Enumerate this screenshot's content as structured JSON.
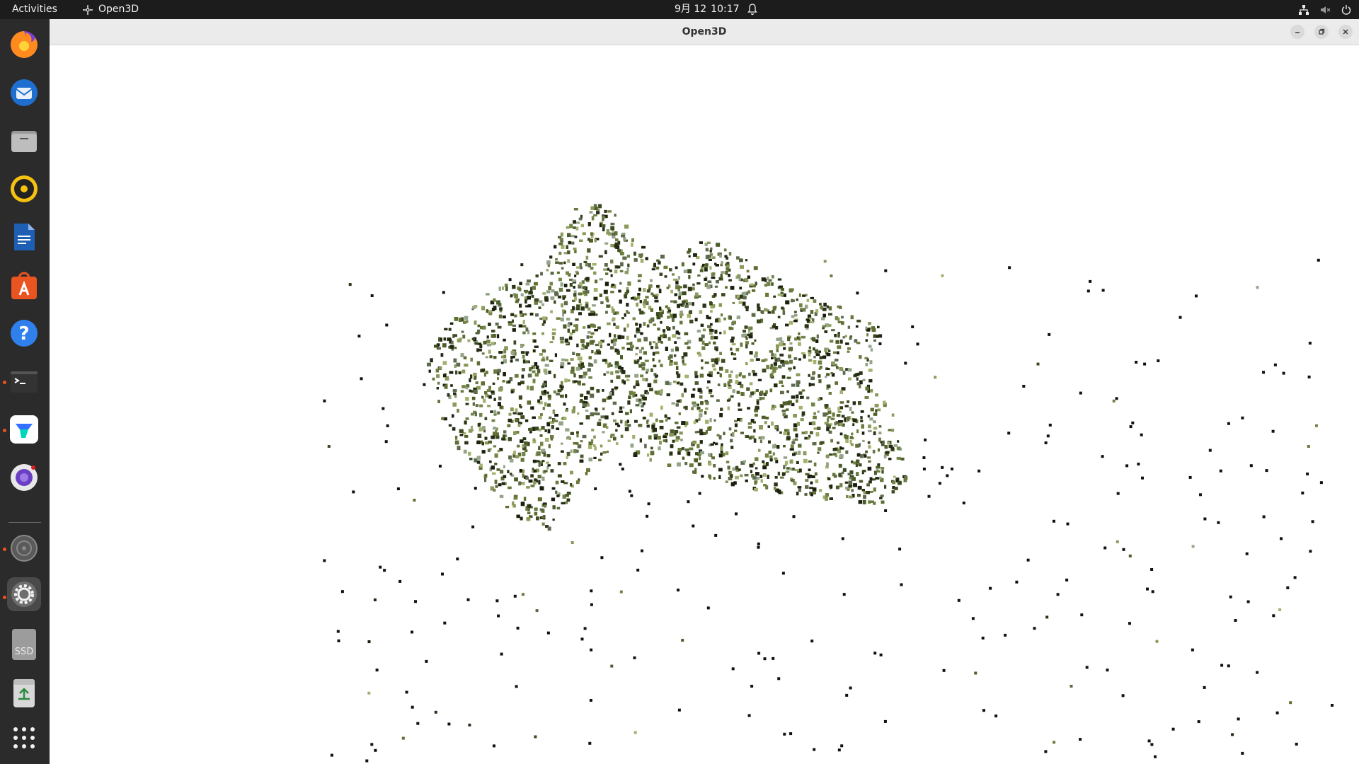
{
  "topbar": {
    "activities_label": "Activities",
    "app_name": "Open3D",
    "clock_date": "9月 12",
    "clock_time": "10:17"
  },
  "dock": {
    "items": [
      {
        "name": "firefox-icon",
        "running": false
      },
      {
        "name": "thunderbird-icon",
        "running": false
      },
      {
        "name": "files-icon",
        "running": false
      },
      {
        "name": "rhythmbox-icon",
        "running": false
      },
      {
        "name": "libreoffice-writer-icon",
        "running": false
      },
      {
        "name": "app-center-icon",
        "running": false
      },
      {
        "name": "help-icon",
        "running": false
      },
      {
        "name": "terminal-icon",
        "running": true
      },
      {
        "name": "feishu-icon",
        "running": true
      },
      {
        "name": "screenshot-icon",
        "running": false
      },
      {
        "name": "disc-drive-icon",
        "running": true
      },
      {
        "name": "settings-icon",
        "running": true
      },
      {
        "name": "ssd-drive-icon",
        "running": false
      },
      {
        "name": "trash-icon",
        "running": false
      },
      {
        "name": "show-apps-icon",
        "running": false
      }
    ],
    "ssd_label": "SSD"
  },
  "window": {
    "title": "Open3D"
  },
  "colors": {
    "topbar_bg": "#1c1c1c",
    "dock_bg": "#2b2b2b",
    "accent": "#e95420",
    "foliage_dark": "#2f3a1c",
    "foliage_mid": "#4d5d2a",
    "foliage_light": "#8a9a5a"
  }
}
